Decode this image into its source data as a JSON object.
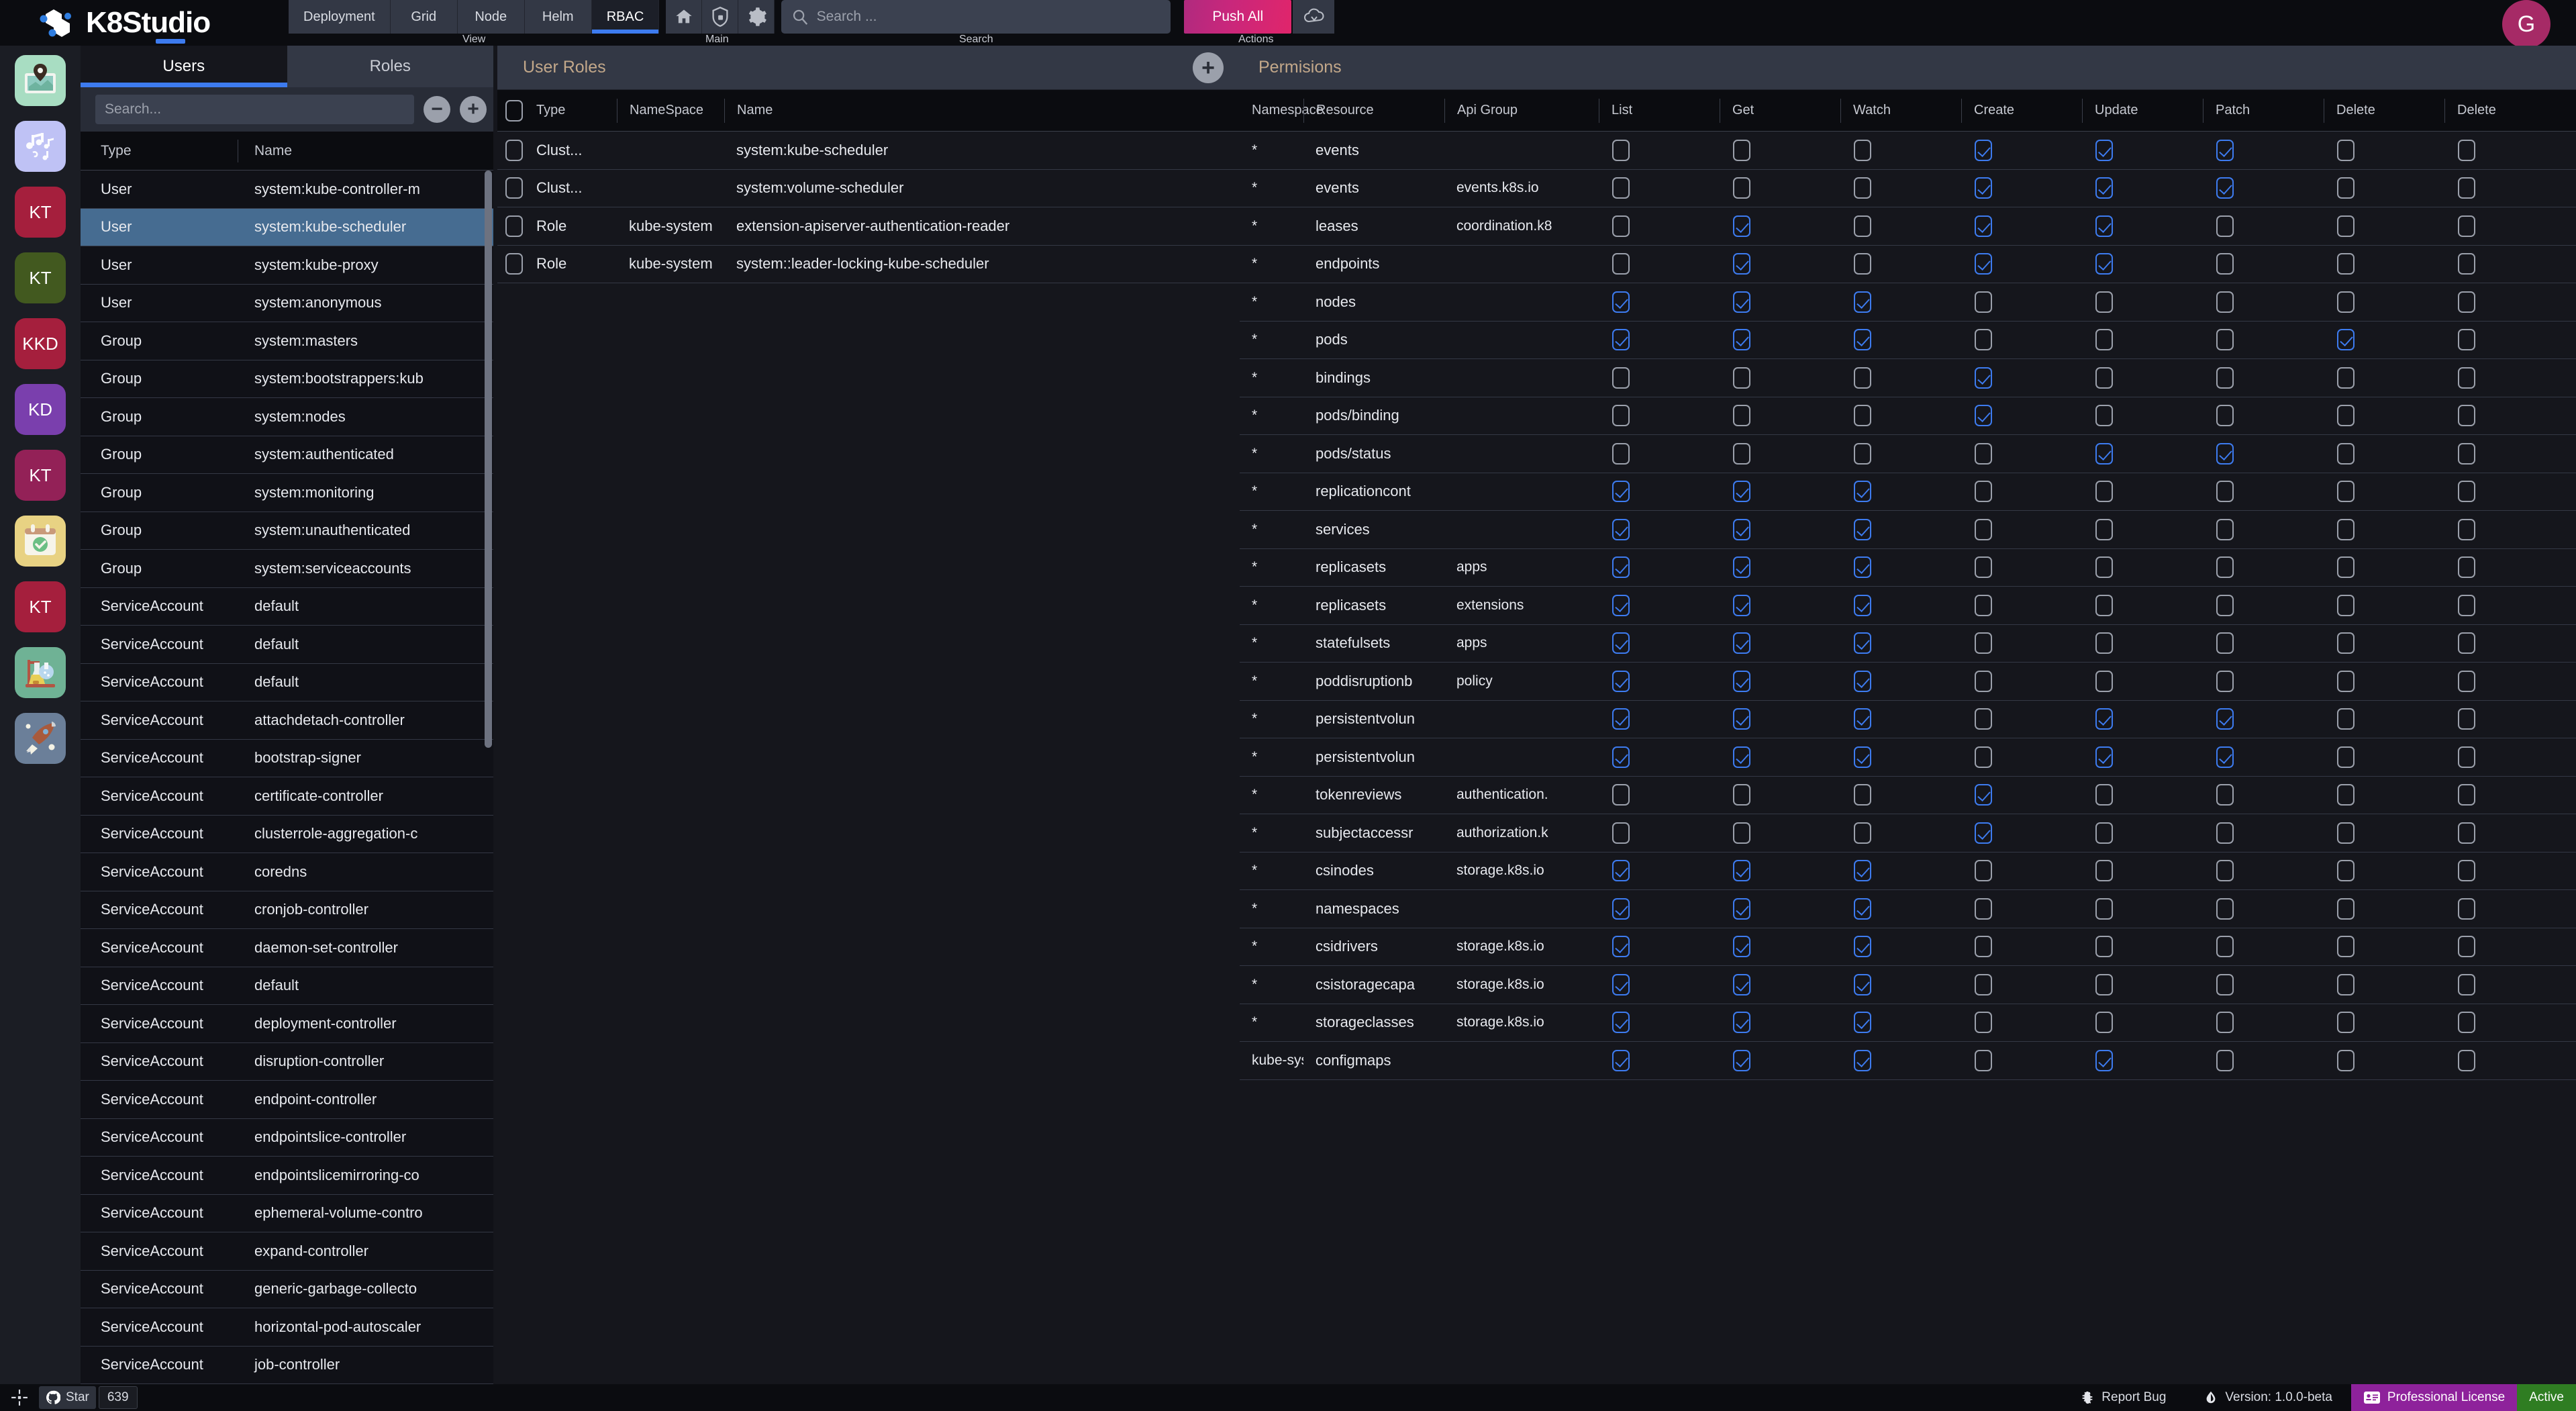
{
  "app": {
    "brand_k8": "K8",
    "brand_studio": "Studio"
  },
  "topbar": {
    "view_caption": "View",
    "main_caption": "Main",
    "search_caption": "Search",
    "actions_caption": "Actions",
    "tabs": [
      {
        "label": "Deployment",
        "active": false
      },
      {
        "label": "Grid",
        "active": false
      },
      {
        "label": "Node",
        "active": false
      },
      {
        "label": "Helm",
        "active": false
      },
      {
        "label": "RBAC",
        "active": true
      }
    ],
    "icons": [
      "home-icon",
      "shield-lock-icon",
      "gear-icon"
    ],
    "search_placeholder": "Search ...",
    "push_all_label": "Push All",
    "cloud_icon": "cloud-sync-icon",
    "avatar_initial": "G",
    "accent_blue": "#3d7bef",
    "avatar_color": "#a62a66"
  },
  "rail": {
    "items": [
      {
        "name": "map-app-icon",
        "label": "",
        "bg": "#a8ddc2",
        "kind": "map",
        "selected": false
      },
      {
        "name": "music-app-icon",
        "label": "",
        "bg": "#bfc2f5",
        "kind": "music",
        "selected": false
      },
      {
        "name": "cluster-kt-red-1",
        "label": "KT",
        "bg": "#a51f3d",
        "kind": "text",
        "selected": false
      },
      {
        "name": "cluster-kt-green",
        "label": "KT",
        "bg": "#42591f",
        "kind": "text",
        "selected": false
      },
      {
        "name": "cluster-kkd-red",
        "label": "KKD",
        "bg": "#a51f3d",
        "kind": "text",
        "selected": false
      },
      {
        "name": "cluster-kd-purple",
        "label": "KD",
        "bg": "#7a3fad",
        "kind": "text",
        "selected": false
      },
      {
        "name": "cluster-kt-magenta",
        "label": "KT",
        "bg": "#932157",
        "kind": "text",
        "selected": false
      },
      {
        "name": "calendar-app-icon",
        "label": "",
        "bg": "#e8d283",
        "kind": "calendar",
        "selected": false
      },
      {
        "name": "cluster-kt-red-2",
        "label": "KT",
        "bg": "#a51f3d",
        "kind": "text",
        "selected": false
      },
      {
        "name": "lab-app-icon",
        "label": "",
        "bg": "#6fb295",
        "kind": "lab",
        "selected": false
      },
      {
        "name": "rocket-app-icon",
        "label": "",
        "bg": "#6b7f99",
        "kind": "rocket",
        "selected": true
      }
    ]
  },
  "users_panel": {
    "tabs": [
      {
        "label": "Users",
        "active": true
      },
      {
        "label": "Roles",
        "active": false
      }
    ],
    "search_placeholder": "Search...",
    "minus_label": "−",
    "plus_label": "+",
    "columns": [
      "Type",
      "Name"
    ],
    "rows": [
      {
        "type": "User",
        "name": "system:kube-controller-m",
        "selected": false
      },
      {
        "type": "User",
        "name": "system:kube-scheduler",
        "selected": true
      },
      {
        "type": "User",
        "name": "system:kube-proxy",
        "selected": false
      },
      {
        "type": "User",
        "name": "system:anonymous",
        "selected": false
      },
      {
        "type": "Group",
        "name": "system:masters",
        "selected": false
      },
      {
        "type": "Group",
        "name": "system:bootstrappers:kub",
        "selected": false
      },
      {
        "type": "Group",
        "name": "system:nodes",
        "selected": false
      },
      {
        "type": "Group",
        "name": "system:authenticated",
        "selected": false
      },
      {
        "type": "Group",
        "name": "system:monitoring",
        "selected": false
      },
      {
        "type": "Group",
        "name": "system:unauthenticated",
        "selected": false
      },
      {
        "type": "Group",
        "name": "system:serviceaccounts",
        "selected": false
      },
      {
        "type": "ServiceAccount",
        "name": "default",
        "selected": false
      },
      {
        "type": "ServiceAccount",
        "name": "default",
        "selected": false
      },
      {
        "type": "ServiceAccount",
        "name": "default",
        "selected": false
      },
      {
        "type": "ServiceAccount",
        "name": "attachdetach-controller",
        "selected": false
      },
      {
        "type": "ServiceAccount",
        "name": "bootstrap-signer",
        "selected": false
      },
      {
        "type": "ServiceAccount",
        "name": "certificate-controller",
        "selected": false
      },
      {
        "type": "ServiceAccount",
        "name": "clusterrole-aggregation-c",
        "selected": false
      },
      {
        "type": "ServiceAccount",
        "name": "coredns",
        "selected": false
      },
      {
        "type": "ServiceAccount",
        "name": "cronjob-controller",
        "selected": false
      },
      {
        "type": "ServiceAccount",
        "name": "daemon-set-controller",
        "selected": false
      },
      {
        "type": "ServiceAccount",
        "name": "default",
        "selected": false
      },
      {
        "type": "ServiceAccount",
        "name": "deployment-controller",
        "selected": false
      },
      {
        "type": "ServiceAccount",
        "name": "disruption-controller",
        "selected": false
      },
      {
        "type": "ServiceAccount",
        "name": "endpoint-controller",
        "selected": false
      },
      {
        "type": "ServiceAccount",
        "name": "endpointslice-controller",
        "selected": false
      },
      {
        "type": "ServiceAccount",
        "name": "endpointslicemirroring-co",
        "selected": false
      },
      {
        "type": "ServiceAccount",
        "name": "ephemeral-volume-contro",
        "selected": false
      },
      {
        "type": "ServiceAccount",
        "name": "expand-controller",
        "selected": false
      },
      {
        "type": "ServiceAccount",
        "name": "generic-garbage-collecto",
        "selected": false
      },
      {
        "type": "ServiceAccount",
        "name": "horizontal-pod-autoscaler",
        "selected": false
      },
      {
        "type": "ServiceAccount",
        "name": "job-controller",
        "selected": false
      }
    ]
  },
  "user_roles_panel": {
    "title": "User Roles",
    "add_label": "+",
    "columns": [
      "Type",
      "NameSpace",
      "Name"
    ],
    "rows": [
      {
        "checked": false,
        "type": "Clust...",
        "namespace": "",
        "name": "system:kube-scheduler"
      },
      {
        "checked": false,
        "type": "Clust...",
        "namespace": "",
        "name": "system:volume-scheduler"
      },
      {
        "checked": false,
        "type": "Role",
        "namespace": "kube-system",
        "name": "extension-apiserver-authentication-reader"
      },
      {
        "checked": false,
        "type": "Role",
        "namespace": "kube-system",
        "name": "system::leader-locking-kube-scheduler"
      }
    ]
  },
  "permissions_panel": {
    "title": "Permisions",
    "columns": [
      "Namespace",
      "Resource",
      "Api Group",
      "List",
      "Get",
      "Watch",
      "Create",
      "Update",
      "Patch",
      "Delete",
      "Delete"
    ],
    "verb_columns": [
      "List",
      "Get",
      "Watch",
      "Create",
      "Update",
      "Patch",
      "Delete",
      "Delete"
    ],
    "rows": [
      {
        "namespace": "*",
        "resource": "events",
        "api_group": "",
        "verbs": [
          false,
          false,
          false,
          true,
          true,
          true,
          false,
          false
        ]
      },
      {
        "namespace": "*",
        "resource": "events",
        "api_group": "events.k8s.io",
        "verbs": [
          false,
          false,
          false,
          true,
          true,
          true,
          false,
          false
        ]
      },
      {
        "namespace": "*",
        "resource": "leases",
        "api_group": "coordination.k8",
        "verbs": [
          false,
          true,
          false,
          true,
          true,
          false,
          false,
          false
        ]
      },
      {
        "namespace": "*",
        "resource": "endpoints",
        "api_group": "",
        "verbs": [
          false,
          true,
          false,
          true,
          true,
          false,
          false,
          false
        ]
      },
      {
        "namespace": "*",
        "resource": "nodes",
        "api_group": "",
        "verbs": [
          true,
          true,
          true,
          false,
          false,
          false,
          false,
          false
        ]
      },
      {
        "namespace": "*",
        "resource": "pods",
        "api_group": "",
        "verbs": [
          true,
          true,
          true,
          false,
          false,
          false,
          true,
          false
        ]
      },
      {
        "namespace": "*",
        "resource": "bindings",
        "api_group": "",
        "verbs": [
          false,
          false,
          false,
          true,
          false,
          false,
          false,
          false
        ]
      },
      {
        "namespace": "*",
        "resource": "pods/binding",
        "api_group": "",
        "verbs": [
          false,
          false,
          false,
          true,
          false,
          false,
          false,
          false
        ]
      },
      {
        "namespace": "*",
        "resource": "pods/status",
        "api_group": "",
        "verbs": [
          false,
          false,
          false,
          false,
          true,
          true,
          false,
          false
        ]
      },
      {
        "namespace": "*",
        "resource": "replicationcont",
        "api_group": "",
        "verbs": [
          true,
          true,
          true,
          false,
          false,
          false,
          false,
          false
        ]
      },
      {
        "namespace": "*",
        "resource": "services",
        "api_group": "",
        "verbs": [
          true,
          true,
          true,
          false,
          false,
          false,
          false,
          false
        ]
      },
      {
        "namespace": "*",
        "resource": "replicasets",
        "api_group": "apps",
        "verbs": [
          true,
          true,
          true,
          false,
          false,
          false,
          false,
          false
        ]
      },
      {
        "namespace": "*",
        "resource": "replicasets",
        "api_group": "extensions",
        "verbs": [
          true,
          true,
          true,
          false,
          false,
          false,
          false,
          false
        ]
      },
      {
        "namespace": "*",
        "resource": "statefulsets",
        "api_group": "apps",
        "verbs": [
          true,
          true,
          true,
          false,
          false,
          false,
          false,
          false
        ]
      },
      {
        "namespace": "*",
        "resource": "poddisruptionb",
        "api_group": "policy",
        "verbs": [
          true,
          true,
          true,
          false,
          false,
          false,
          false,
          false
        ]
      },
      {
        "namespace": "*",
        "resource": "persistentvolun",
        "api_group": "",
        "verbs": [
          true,
          true,
          true,
          false,
          true,
          true,
          false,
          false
        ]
      },
      {
        "namespace": "*",
        "resource": "persistentvolun",
        "api_group": "",
        "verbs": [
          true,
          true,
          true,
          false,
          true,
          true,
          false,
          false
        ]
      },
      {
        "namespace": "*",
        "resource": "tokenreviews",
        "api_group": "authentication.",
        "verbs": [
          false,
          false,
          false,
          true,
          false,
          false,
          false,
          false
        ]
      },
      {
        "namespace": "*",
        "resource": "subjectaccessr",
        "api_group": "authorization.k",
        "verbs": [
          false,
          false,
          false,
          true,
          false,
          false,
          false,
          false
        ]
      },
      {
        "namespace": "*",
        "resource": "csinodes",
        "api_group": "storage.k8s.io",
        "verbs": [
          true,
          true,
          true,
          false,
          false,
          false,
          false,
          false
        ]
      },
      {
        "namespace": "*",
        "resource": "namespaces",
        "api_group": "",
        "verbs": [
          true,
          true,
          true,
          false,
          false,
          false,
          false,
          false
        ]
      },
      {
        "namespace": "*",
        "resource": "csidrivers",
        "api_group": "storage.k8s.io",
        "verbs": [
          true,
          true,
          true,
          false,
          false,
          false,
          false,
          false
        ]
      },
      {
        "namespace": "*",
        "resource": "csistoragecapa",
        "api_group": "storage.k8s.io",
        "verbs": [
          true,
          true,
          true,
          false,
          false,
          false,
          false,
          false
        ]
      },
      {
        "namespace": "*",
        "resource": "storageclasses",
        "api_group": "storage.k8s.io",
        "verbs": [
          true,
          true,
          true,
          false,
          false,
          false,
          false,
          false
        ]
      },
      {
        "namespace": "kube-system",
        "resource": "configmaps",
        "api_group": "",
        "verbs": [
          true,
          true,
          true,
          false,
          true,
          false,
          false,
          false
        ]
      }
    ]
  },
  "statusbar": {
    "star_label": "Star",
    "star_count": "639",
    "report_bug_label": "Report Bug",
    "version_label": "Version: 1.0.0-beta",
    "license_label": "Professional License",
    "license_state": "Active",
    "license_color": "#8e229b",
    "active_color": "#2f7d22"
  }
}
